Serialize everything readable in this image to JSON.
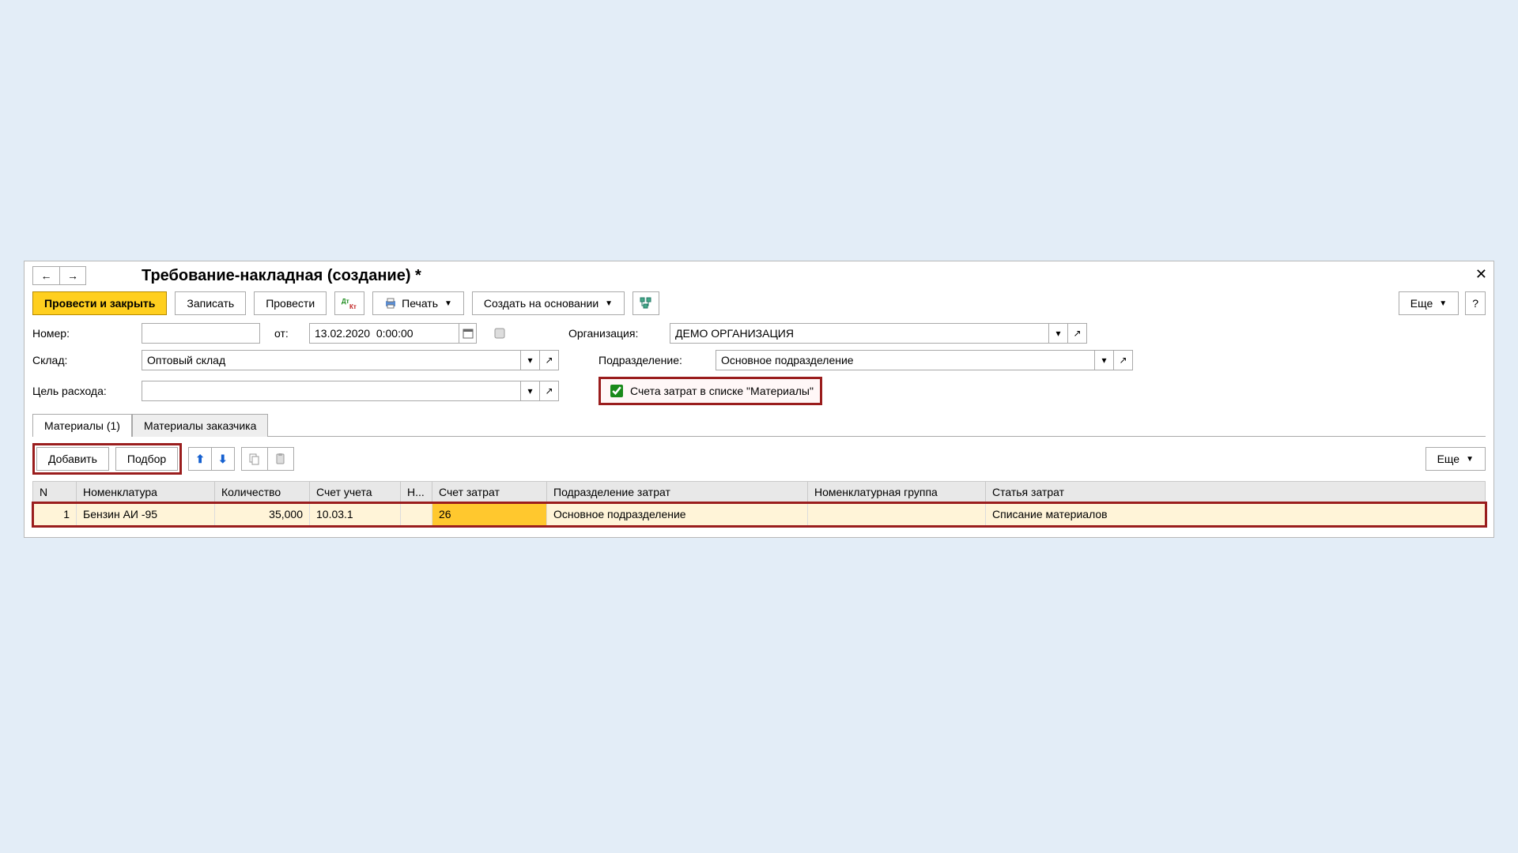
{
  "window": {
    "title": "Требование-накладная (создание) *"
  },
  "toolbar": {
    "post_close": "Провести и закрыть",
    "save": "Записать",
    "post": "Провести",
    "print": "Печать",
    "create_based": "Создать на основании",
    "more": "Еще"
  },
  "form": {
    "number_label": "Номер:",
    "number_value": "",
    "from_label": "от:",
    "date_value": "13.02.2020  0:00:00",
    "org_label": "Организация:",
    "org_value": "ДЕМО ОРГАНИЗАЦИЯ",
    "warehouse_label": "Склад:",
    "warehouse_value": "Оптовый склад",
    "dept_label": "Подразделение:",
    "dept_value": "Основное подразделение",
    "purpose_label": "Цель расхода:",
    "purpose_value": "",
    "cost_accounts_label": "Счета затрат в списке \"Материалы\""
  },
  "tabs": {
    "materials": "Материалы (1)",
    "customer_materials": "Материалы заказчика"
  },
  "gridbar": {
    "add": "Добавить",
    "select": "Подбор",
    "more": "Еще"
  },
  "table": {
    "headers": {
      "n": "N",
      "item": "Номенклатура",
      "qty": "Количество",
      "acct": "Счет учета",
      "h": "Н...",
      "cost_acct": "Счет затрат",
      "cost_dept": "Подразделение затрат",
      "nom_group": "Номенклатурная группа",
      "cost_article": "Статья затрат"
    },
    "rows": [
      {
        "n": "1",
        "item": "Бензин АИ -95",
        "qty": "35,000",
        "acct": "10.03.1",
        "h": "",
        "cost_acct": "26",
        "cost_dept": "Основное подразделение",
        "nom_group": "",
        "cost_article": "Списание материалов"
      }
    ]
  }
}
